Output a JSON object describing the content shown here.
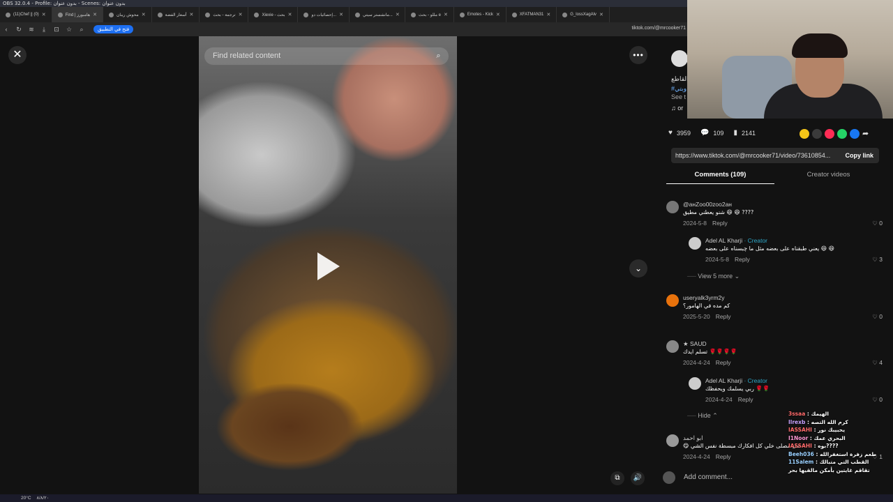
{
  "obs_title": "OBS 32.0.4 - Profile: بدون عنوان - Scenes: بدون عنوان",
  "tabs": [
    {
      "label": "(11)Chef || (0)"
    },
    {
      "label": "Find | هامبورز",
      "active": true
    },
    {
      "label": "محوش ريبان"
    },
    {
      "label": "أسعار الفضة"
    },
    {
      "label": "ترجمة - بحث"
    },
    {
      "label": "Xiexie - بحث"
    },
    {
      "label": "إحصائيات دو..."
    },
    {
      "label": "مانشستر سيتي..."
    },
    {
      "label": "مللو - بحث e"
    },
    {
      "label": "Emotes - Kick"
    },
    {
      "label": "XFATMAN31"
    },
    {
      "label": "G_lossXagAlv"
    }
  ],
  "address_bar": {
    "open_app_label": "فتح في التطبيق",
    "url": "tiktok.com/@mrcooker71"
  },
  "video": {
    "search_placeholder": "Find related content",
    "close_icon": "close-icon",
    "more_icon": "more-icon"
  },
  "post": {
    "caption_partial": "القاطع",
    "hashtag_partial": "#وبتي",
    "see_translation_partial": "See t",
    "music_partial": "or",
    "likes": "3959",
    "comments": "109",
    "saves": "2141",
    "share_colors": [
      "#f5c518",
      "#3a3a3a",
      "#fe2c55",
      "#25d366",
      "#1877f2"
    ],
    "link_url": "https://www.tiktok.com/@mrcooker71/video/73610854...",
    "copy_link": "Copy link"
  },
  "comment_tabs": {
    "comments": "Comments (109)",
    "creator_videos": "Creator videos"
  },
  "comments": [
    {
      "user": "@aнZoo00zoo2aн",
      "text": "شنو يعطني مطيق 😆 😆 ????",
      "date": "2024-5-8",
      "reply": "Reply",
      "likes": "0"
    },
    {
      "user": "Adel AL Kharji",
      "creator": "· Creator",
      "text": "يعني طبقناه على بعضه مثل ما چبسناه على بعضه 😆 😆",
      "date": "2024-5-8",
      "reply": "Reply",
      "likes": "3"
    },
    {
      "user": "useryalk3yrm2y",
      "text": "كم مده في الهامور؟",
      "date": "2025-5-20",
      "reply": "Reply",
      "likes": "0"
    },
    {
      "user": "★ SAUD",
      "text": "تسلم ايدك 🌹🌹🌹🌹",
      "date": "2024-4-24",
      "reply": "Reply",
      "likes": "4"
    },
    {
      "user": "Adel AL Kharji",
      "creator": "· Creator",
      "text": "ربي يسلمك ويحفظك 🌹🌹",
      "date": "2024-4-24",
      "reply": "Reply",
      "likes": "0"
    },
    {
      "user": "ابو احمد",
      "text": "😋 صل مصلى خلي كل افكارك مبسطة نفس الشي",
      "date": "2024-4-24",
      "reply": "Reply",
      "likes": "1"
    }
  ],
  "view_more": "View 5 more",
  "hide": "Hide",
  "add_comment": "Add comment...",
  "chat": [
    {
      "name": "3ssaa",
      "msg": ": الهيمك",
      "cls": "n1"
    },
    {
      "name": "Ilrexb",
      "msg": ": كرم الله التصه",
      "cls": "n2"
    },
    {
      "name": "IASSAHI",
      "msg": ": يحبيبك نور",
      "cls": "n1"
    },
    {
      "name": "I1Noor",
      "msg": ": البحري عمك",
      "cls": "n3"
    },
    {
      "name": "IASSAHI",
      "msg": ": بوه????",
      "cls": "n1"
    },
    {
      "name": "Beeh036",
      "msg": ": طعم زفرة استغفرالله",
      "cls": "n4"
    },
    {
      "name": "11Salem",
      "msg": ": القطب التي متبالك",
      "cls": "n4"
    },
    {
      "name": "",
      "msg": "تقاقم غايتين بأمكن مالقيها بحر",
      "cls": ""
    }
  ],
  "taskbar": {
    "weather": "20°C",
    "clock": "۸/۸/۲۰"
  }
}
